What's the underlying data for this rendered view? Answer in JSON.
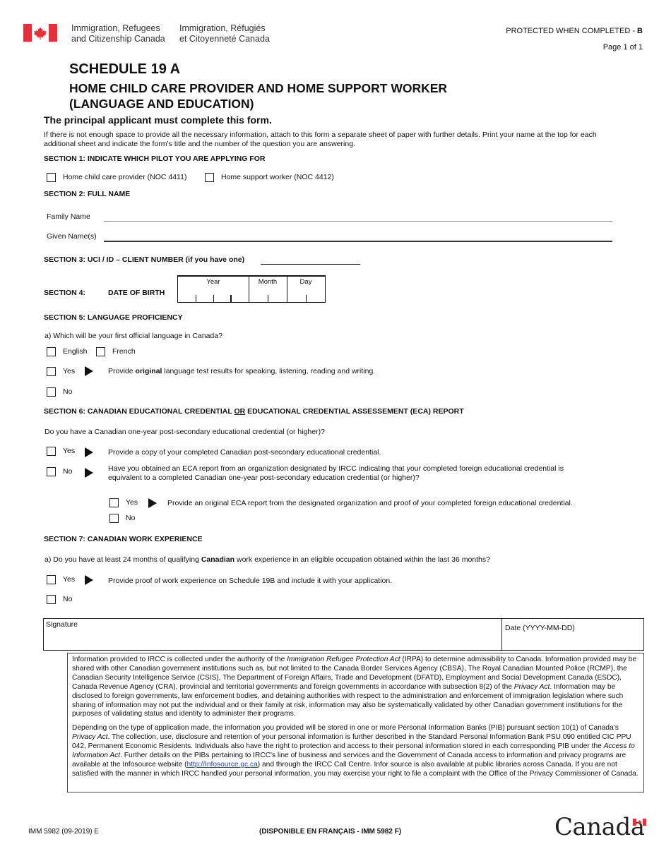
{
  "header": {
    "dept_en": [
      "Immigration, Refugees",
      "and Citizenship Canada"
    ],
    "dept_fr": [
      "Immigration, Réfugiés",
      "et Citoyenneté Canada"
    ],
    "protected": "PROTECTED WHEN COMPLETED - ",
    "protected_level": "B",
    "page": "Page 1 of 1"
  },
  "title": {
    "schedule": "SCHEDULE 19 A",
    "line1": "HOME CHILD CARE PROVIDER AND HOME SUPPORT WORKER",
    "line2": "(LANGUAGE AND EDUCATION)"
  },
  "intro": {
    "principal": "The principal applicant must complete this form.",
    "instructions": "If there is not enough space to provide all the necessary information, attach to this form a separate sheet of paper with further details. Print your name at the top for each additional sheet and indicate the form's title and the number of the question you are answering."
  },
  "section1": {
    "heading": "SECTION 1: INDICATE WHICH PILOT YOU ARE APPLYING FOR",
    "options": [
      "Home child care provider (NOC 4411)",
      "Home support worker (NOC 4412)"
    ]
  },
  "section2": {
    "heading": "SECTION 2: FULL NAME",
    "family_label": "Family Name",
    "family_value": "",
    "given_label": "Given Name(s)",
    "given_value": ""
  },
  "section3": {
    "heading": "SECTION 3: UCI / ID – CLIENT NUMBER (if you have one)",
    "value": ""
  },
  "section4": {
    "heading": "SECTION 4:",
    "label": "DATE  OF BIRTH",
    "year": "Year",
    "month": "Month",
    "day": "Day"
  },
  "section5": {
    "heading": "SECTION 5: LANGUAGE PROFICIENCY",
    "question": "a) Which will be your first official language in Canada?",
    "english": "English",
    "french": "French",
    "yes": "Yes",
    "yes_text_pre": "Provide ",
    "yes_text_bold": "original",
    "yes_text_post": " language test results for speaking, listening, reading and writing.",
    "no": "No"
  },
  "section6": {
    "heading_pre": "SECTION 6: CANADIAN EDUCATIONAL CREDENTIAL ",
    "heading_or": "OR",
    "heading_post": " EDUCATIONAL CREDENTIAL ASSESSEMENT (ECA) REPORT",
    "question": "Do you have a Canadian one-year post-secondary educational credential (or higher)?",
    "yes": "Yes",
    "yes_text": "Provide a copy of your completed Canadian post-secondary educational credential.",
    "no": "No",
    "no_text": "Have you obtained an ECA report from an organization designated by IRCC indicating that your completed foreign educational credential is equivalent to a completed Canadian one-year post-secondary education credential (or higher)?",
    "sub_yes": "Yes",
    "sub_yes_text": "Provide an original ECA report from the designated organization and proof of your completed foreign educational credential.",
    "sub_no": "No"
  },
  "section7": {
    "heading": "SECTION 7: CANADIAN WORK EXPERIENCE",
    "question_pre": "a) Do you have at least 24 months of qualifying ",
    "question_bold": "Canadian",
    "question_post": " work experience in an eligible occupation obtained within the last 36 months?",
    "yes": "Yes",
    "yes_text": "Provide proof of work experience on Schedule 19B and include it with your application.",
    "no": "No"
  },
  "signature": {
    "label": "Signature",
    "date_label": "Date (YYYY-MM-DD)"
  },
  "privacy": {
    "p1_a": "Information provided to IRCC is collected under the authority of the ",
    "p1_act": "Immigration Refugee Protection Act",
    "p1_b": " (IRPA) to determine admissibility to Canada.  Information provided may be shared with other Canadian government institutions such as, but not limited to the Canada Border Services Agency (CBSA), The Royal Canadian Mounted Police (RCMP), the Canadian Security Intelligence Service (CSIS), The Department of Foreign Affairs, Trade and Development (DFATD), Employment and Social Development Canada (ESDC), Canada Revenue Agency (CRA), provincial and territorial governments and foreign governments in accordance with subsection 8(2) of the ",
    "p1_privacy": "Privacy Act",
    "p1_c": ".  Information may be disclosed to foreign governments, law enforcement bodies, and detaining authorities with respect to the administration and enforcement of immigration legislation where such sharing of information may not put the individual and or their family at risk, information may also be systematically validated by other Canadian government institutions for the purposes of validating status and identity to administer their programs.",
    "p2_a": "Depending on the type of application made, the information you provided will be stored in one or more Personal Information Banks (PIB) pursuant section 10(1) of Canada's ",
    "p2_privacy": "Privacy Act",
    "p2_b": ".  The collection, use, disclosure and retention of your personal information is further described in the Standard Personal Information Bank PSU 090 entitled CIC PPU 042, Permanent Economic Residents.  Individuals also have the right to protection and access to their personal information stored in each corresponding PIB under the ",
    "p2_ati": "Access to Information Act",
    "p2_c": ".  Further details on the PIBs pertaining to IRCC's line of business and services and the Government of Canada access to information and privacy programs are available at the Infosource website (",
    "p2_link": "http://Infosource.gc.ca",
    "p2_d": ") and through the IRCC Call Centre.  Infor source is also available at public libraries across Canada.  If you are not satisfied with the manner in which IRCC handled your personal information, you may exercise your right to file a complaint with the Office of the Privacy Commissioner of Canada."
  },
  "footer": {
    "form_number": "IMM 5982 (09-2019) E",
    "french_available": "(DISPONIBLE EN FRANÇAIS - IMM 5982 F)",
    "wordmark": "Canada"
  },
  "colors": {
    "flag_red": "#eb2d37",
    "link": "#1a3fd1"
  }
}
